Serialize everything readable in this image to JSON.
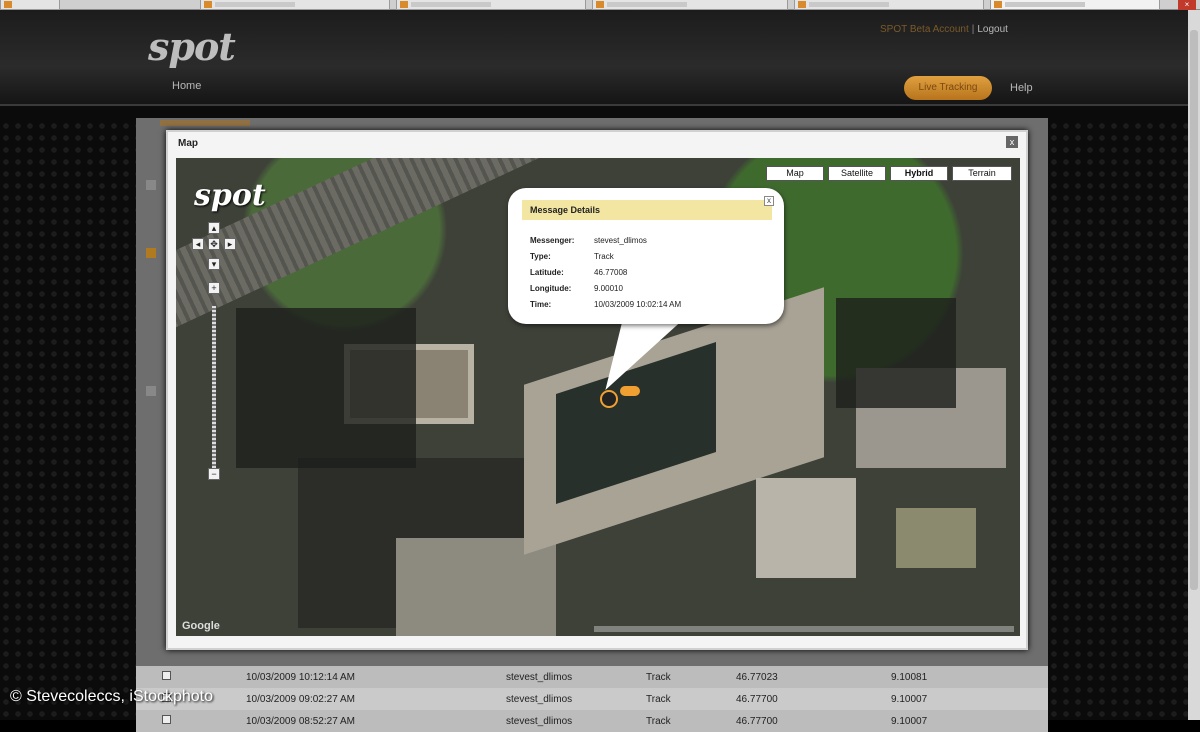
{
  "site": {
    "logo": "spot",
    "nav_home": "Home",
    "nav_button": "Live Tracking",
    "nav_help": "Help",
    "user_info": "SPOT Beta Account",
    "logout": "Logout"
  },
  "modal": {
    "title": "Map",
    "close": "x"
  },
  "map": {
    "logo": "spot",
    "types": [
      "Map",
      "Satellite",
      "Hybrid",
      "Terrain"
    ],
    "selected_type": "Hybrid",
    "zoom_plus": "+",
    "zoom_minus": "−",
    "pan_left": "◂",
    "pan_right": "▸",
    "pan_up": "▴",
    "pan_down": "▾",
    "google": "Google"
  },
  "balloon": {
    "title": "Message Details",
    "close": "x",
    "rows": [
      {
        "label": "Messenger:",
        "value": "stevest_dlimos"
      },
      {
        "label": "Type:",
        "value": "Track"
      },
      {
        "label": "Latitude:",
        "value": "46.77008"
      },
      {
        "label": "Longitude:",
        "value": "9.00010"
      },
      {
        "label": "Time:",
        "value": "10/03/2009 10:02:14 AM"
      }
    ]
  },
  "table": {
    "rows": [
      {
        "time": "10/03/2009 10:12:14 AM",
        "name": "stevest_dlimos",
        "type": "Track",
        "lat": "46.77023",
        "lon": "9.10081"
      },
      {
        "time": "10/03/2009 09:02:27 AM",
        "name": "stevest_dlimos",
        "type": "Track",
        "lat": "46.77700",
        "lon": "9.10007"
      },
      {
        "time": "10/03/2009 08:52:27 AM",
        "name": "stevest_dlimos",
        "type": "Track",
        "lat": "46.77700",
        "lon": "9.10007"
      }
    ]
  },
  "watermark": "© Stevecoleccs, iStockphoto",
  "colors": {
    "accent": "#e0a040",
    "balloon_header": "#f3e6a2",
    "header_bg": "#1c1c1c"
  }
}
